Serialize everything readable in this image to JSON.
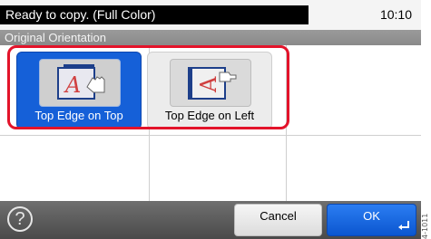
{
  "status": {
    "message": "Ready to copy. (Full Color)",
    "time": "10:10"
  },
  "header": {
    "title": "Original Orientation"
  },
  "options": [
    {
      "label": "Top Edge on Top",
      "selected": true
    },
    {
      "label": "Top Edge on Left",
      "selected": false
    }
  ],
  "footer": {
    "help_symbol": "?",
    "cancel_label": "Cancel",
    "ok_label": "OK"
  },
  "side_text": "4-1011"
}
